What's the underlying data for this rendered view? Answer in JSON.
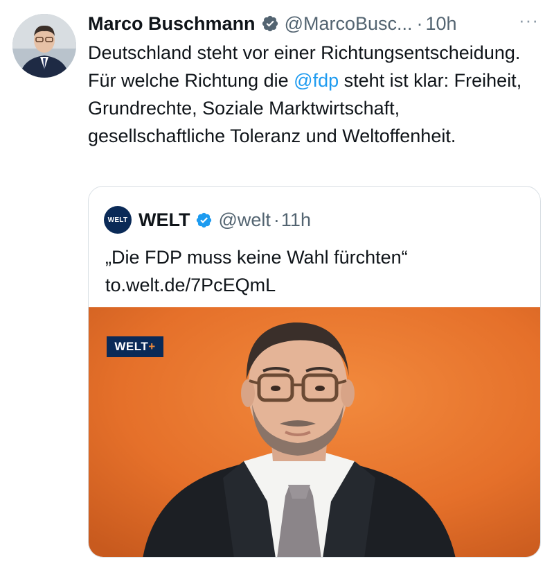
{
  "tweet": {
    "author": {
      "display_name": "Marco Buschmann",
      "handle": "@MarcoBusc...",
      "time": "10h",
      "verified": true
    },
    "more_label": "···",
    "text_parts": {
      "before_mention": "Deutschland steht vor einer Richtungsentscheidung. Für welche Richtung die ",
      "mention": "@fdp",
      "after_mention": " steht ist klar: Freiheit, Grundrechte, Soziale Marktwirtschaft, gesellschaftliche Toleranz und Weltoffenheit."
    }
  },
  "quote": {
    "logo_text": "WELT",
    "display_name": "WELT",
    "handle": "@welt",
    "time": "11h",
    "verified": true,
    "text": "„Die FDP muss keine Wahl fürchten“ to.welt.de/7PcEQmL",
    "media": {
      "badge_text": "WELT",
      "badge_plus": "+"
    }
  },
  "colors": {
    "accent": "#1d9bf0",
    "secondary_text": "#536471",
    "welt_navy": "#0a2a57",
    "photo_background": "#e8742c"
  },
  "icons": {
    "verified": "verified-badge-icon",
    "more": "more-options-icon"
  }
}
